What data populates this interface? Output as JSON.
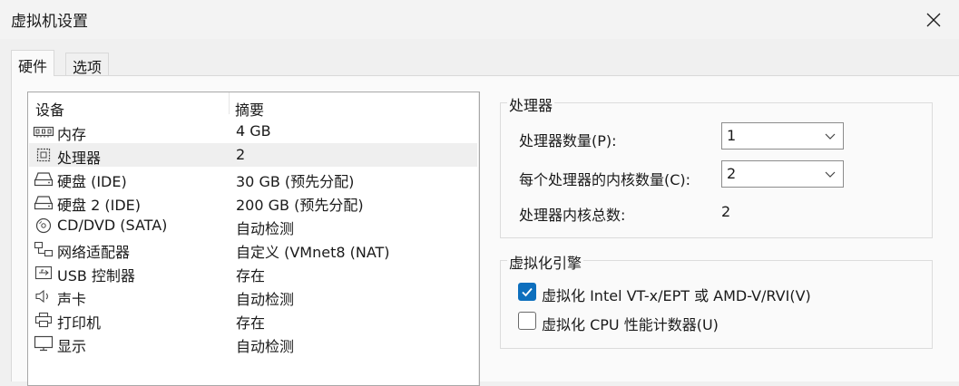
{
  "window": {
    "title": "虚拟机设置"
  },
  "tabs": [
    {
      "label": "硬件"
    },
    {
      "label": "选项"
    }
  ],
  "device_list": {
    "headers": {
      "device": "设备",
      "summary": "摘要"
    },
    "rows": [
      {
        "icon": "memory-icon",
        "device": "内存",
        "summary": "4 GB"
      },
      {
        "icon": "processor-icon",
        "device": "处理器",
        "summary": "2"
      },
      {
        "icon": "hard-disk-icon",
        "device": "硬盘 (IDE)",
        "summary": "30 GB (预先分配)"
      },
      {
        "icon": "hard-disk-icon",
        "device": "硬盘 2 (IDE)",
        "summary": "200 GB (预先分配)"
      },
      {
        "icon": "cd-dvd-icon",
        "device": "CD/DVD (SATA)",
        "summary": "自动检测"
      },
      {
        "icon": "network-adapter-icon",
        "device": "网络适配器",
        "summary": "自定义 (VMnet8 (NAT)"
      },
      {
        "icon": "usb-icon",
        "device": "USB 控制器",
        "summary": "存在"
      },
      {
        "icon": "sound-icon",
        "device": "声卡",
        "summary": "自动检测"
      },
      {
        "icon": "printer-icon",
        "device": "打印机",
        "summary": "存在"
      },
      {
        "icon": "display-icon",
        "device": "显示",
        "summary": "自动检测"
      }
    ],
    "selected_index": 1
  },
  "processor_group": {
    "title": "处理器",
    "count_label": "处理器数量(P):",
    "count_value": "1",
    "cores_label": "每个处理器的内核数量(C):",
    "cores_value": "2",
    "total_label": "处理器内核总数:",
    "total_value": "2"
  },
  "virtualization_group": {
    "title": "虚拟化引擎",
    "options": [
      {
        "label": "虚拟化 Intel VT-x/EPT 或 AMD-V/RVI(V)",
        "checked": true
      },
      {
        "label": "虚拟化 CPU 性能计数器(U)",
        "checked": false
      }
    ]
  },
  "colors": {
    "accent": "#0d6fbd",
    "selected_row": "#efefef"
  }
}
